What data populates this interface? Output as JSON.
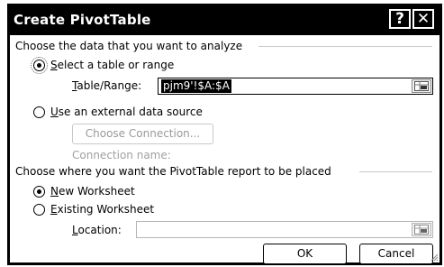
{
  "window": {
    "title": "Create PivotTable",
    "help_glyph": "?",
    "close_glyph": "✕"
  },
  "source_group": {
    "header": "Choose the data that you want to analyze",
    "select_range": {
      "label_ul": "S",
      "label_rest": "elect a table or range",
      "checked": true
    },
    "table_range": {
      "label_ul": "T",
      "label_rest": "able/Range:",
      "value": "pjm9'!$A:$A"
    },
    "external": {
      "label_ul": "U",
      "label_rest": "se an external data source",
      "checked": false
    },
    "choose_connection_label": "Choose Connection...",
    "connection_name_label": "Connection name:"
  },
  "placement_group": {
    "header": "Choose where you want the PivotTable report to be placed",
    "new_worksheet": {
      "label_ul": "N",
      "label_rest": "ew Worksheet",
      "checked": true
    },
    "existing_worksheet": {
      "label_ul": "E",
      "label_rest": "xisting Worksheet",
      "checked": false
    },
    "location": {
      "label_ul": "L",
      "label_rest": "ocation:",
      "value": ""
    }
  },
  "buttons": {
    "ok": "OK",
    "cancel": "Cancel"
  },
  "icons": {
    "range_picker": "range-picker-icon",
    "resize_grip": "resize-grip-icon"
  }
}
